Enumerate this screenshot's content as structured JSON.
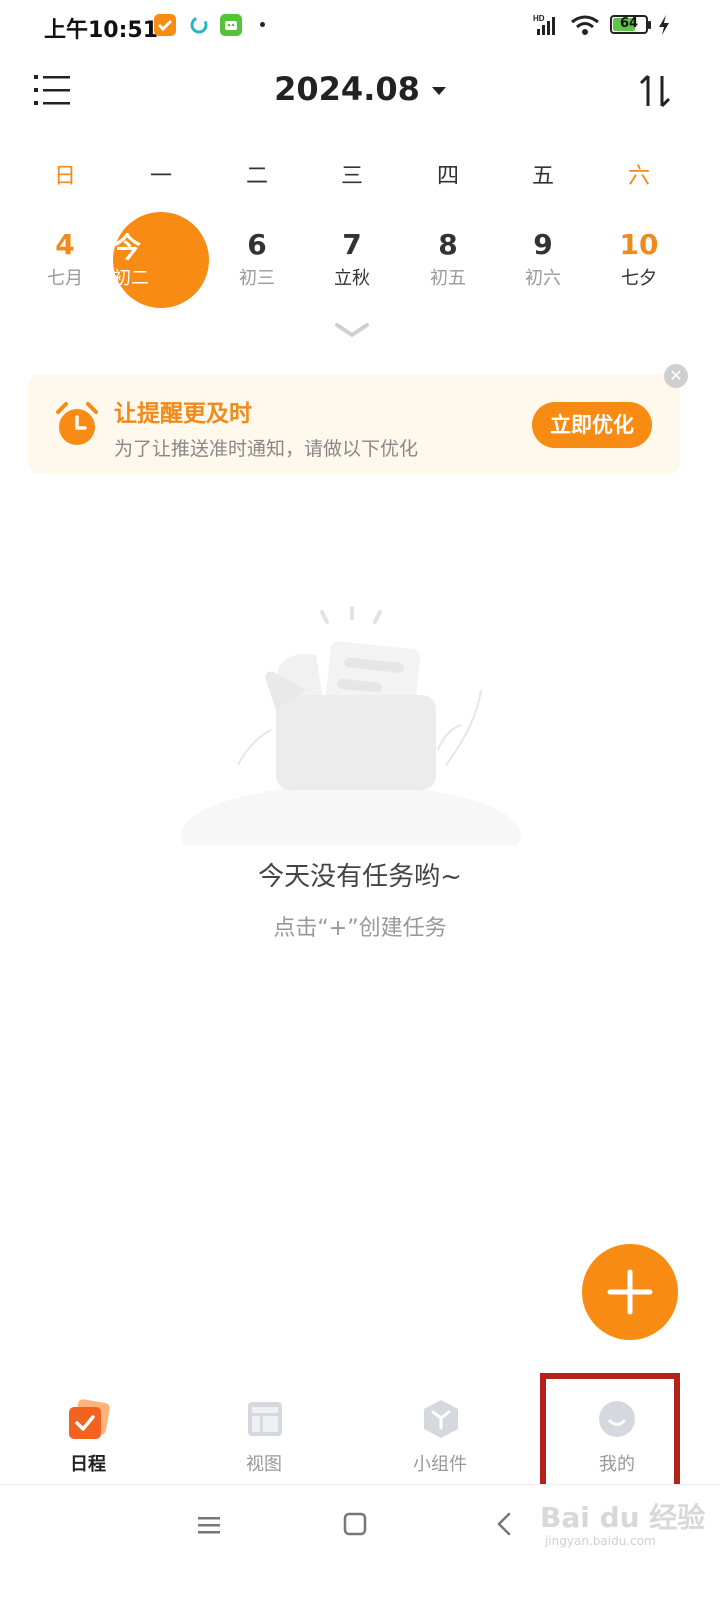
{
  "status_bar": {
    "time": "上午10:51",
    "battery": "64",
    "network": "HD"
  },
  "header": {
    "month": "2024.08",
    "menu_icon": "menu-icon",
    "sort_icon": "sort-icon"
  },
  "week": {
    "weekdays": [
      "日",
      "一",
      "二",
      "三",
      "四",
      "五",
      "六"
    ],
    "days": [
      {
        "num": "4",
        "sub": "七月"
      },
      {
        "num": "今",
        "sub": "初二"
      },
      {
        "num": "6",
        "sub": "初三"
      },
      {
        "num": "7",
        "sub": "立秋"
      },
      {
        "num": "8",
        "sub": "初五"
      },
      {
        "num": "9",
        "sub": "初六"
      },
      {
        "num": "10",
        "sub": "七夕"
      }
    ]
  },
  "banner": {
    "title": "让提醒更及时",
    "subtitle": "为了让推送准时通知，请做以下优化",
    "button": "立即优化"
  },
  "empty_state": {
    "title": "今天没有任务哟~",
    "subtitle": "点击“+”创建任务"
  },
  "bottom_nav": [
    {
      "label": "日程",
      "icon": "schedule-icon",
      "active": true
    },
    {
      "label": "视图",
      "icon": "view-icon",
      "active": false
    },
    {
      "label": "小组件",
      "icon": "widget-icon",
      "active": false
    },
    {
      "label": "我的",
      "icon": "profile-icon",
      "active": false
    }
  ],
  "watermark": {
    "text": "Bai du 经验",
    "url": "jingyan.baidu.com"
  },
  "colors": {
    "accent": "#f78b14",
    "highlight": "#b3211a"
  }
}
